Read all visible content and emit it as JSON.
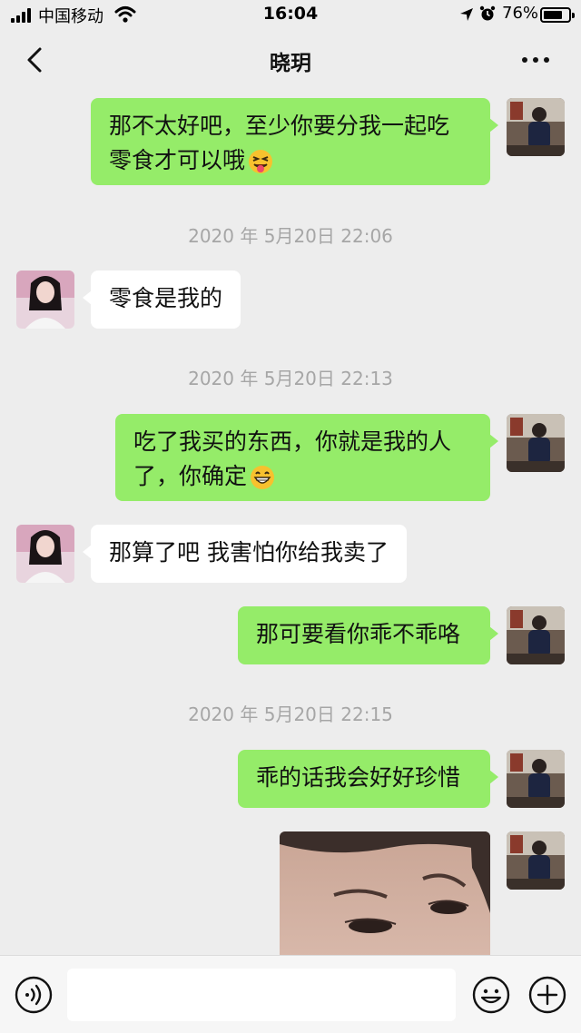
{
  "status_bar": {
    "carrier": "中国移动",
    "time": "16:04",
    "battery": "76%",
    "battery_level": 0.76,
    "icons": [
      "signal-icon",
      "wifi-icon",
      "location-icon",
      "alarm-icon",
      "battery-icon"
    ]
  },
  "header": {
    "title": "晓玥",
    "back_icon": "chevron-left-icon",
    "more_icon": "more-dots-icon"
  },
  "messages": [
    {
      "from": "me",
      "lines": [
        "那不太好吧，至少你要分我一起吃",
        "零食才可以哦"
      ],
      "emoji": "squinting-tongue-emoji"
    },
    {
      "type": "timestamp",
      "text": "2020 年 5月20日 22:06"
    },
    {
      "from": "them",
      "lines": [
        "零食是我的"
      ]
    },
    {
      "type": "timestamp",
      "text": "2020 年 5月20日 22:13"
    },
    {
      "from": "me",
      "lines": [
        "吃了我买的东西，你就是我的人",
        "了，你确定"
      ],
      "emoji": "grinning-emoji"
    },
    {
      "from": "them",
      "lines": [
        "那算了吧 我害怕你给我卖了"
      ]
    },
    {
      "from": "me",
      "lines": [
        "那可要看你乖不乖咯"
      ]
    },
    {
      "type": "timestamp",
      "text": "2020 年 5月20日 22:15"
    },
    {
      "from": "me",
      "lines": [
        "乖的话我会好好珍惜"
      ]
    },
    {
      "from": "me",
      "type": "image",
      "description_icon": "photo-message"
    }
  ],
  "input_bar": {
    "voice_icon": "voice-icon",
    "text_value": "",
    "emoji_icon": "emoji-icon",
    "plus_icon": "plus-icon"
  },
  "colors": {
    "background": "#ededed",
    "my_bubble": "#95ec69",
    "their_bubble": "#ffffff",
    "timestamp": "#a6a6a6"
  }
}
